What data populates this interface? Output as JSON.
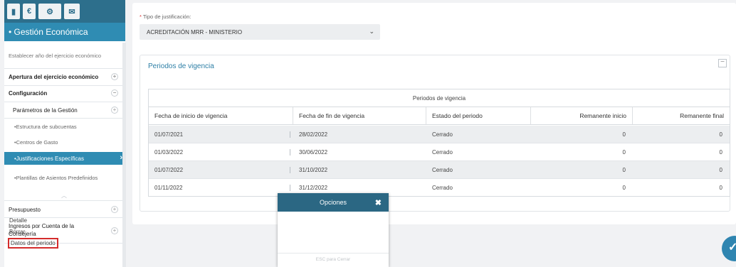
{
  "top_tabs": [
    {
      "icon": "book-icon",
      "glyph": "▮"
    },
    {
      "icon": "euro-icon",
      "glyph": "€"
    },
    {
      "icon": "cogs-icon",
      "glyph": "⚙"
    },
    {
      "icon": "mail-icon",
      "glyph": "✉"
    }
  ],
  "sidebar": {
    "header": "• Gestión Económica",
    "items": [
      {
        "label": "Establecer año del ejercicio económico"
      },
      {
        "label": "Apertura del ejercicio económico"
      },
      {
        "label": "Configuración"
      },
      {
        "label": "Parámetros de la Gestión"
      },
      {
        "label": "•Estructura de subcuentas"
      },
      {
        "label": "•Centros de Gasto"
      },
      {
        "label": "•Justificaciones Específicas"
      },
      {
        "label": "•Plantillas de Asientos Predefinidos"
      },
      {
        "label": "Presupuesto"
      },
      {
        "label": "Ingresos por Cuenta de la Consejería"
      }
    ]
  },
  "form": {
    "required_mark": "*",
    "label": "Tipo de justificación:",
    "selected_value": "ACREDITACIÓN MRR - MINISTERIO"
  },
  "card": {
    "title": "Periodos de vigencia"
  },
  "grid": {
    "title": "Periodos de vigencia",
    "columns": [
      "Fecha de inicio de vigencia",
      "Fecha de fin de vigencia",
      "Estado del periodo",
      "Remanente inicio",
      "Remanente final"
    ],
    "rows": [
      {
        "inicio": "01/07/2021",
        "fin": "28/02/2022",
        "estado": "Cerrado",
        "rem_inicio": "0",
        "rem_final": "0"
      },
      {
        "inicio": "01/03/2022",
        "fin": "30/06/2022",
        "estado": "Cerrado",
        "rem_inicio": "0",
        "rem_final": "0"
      },
      {
        "inicio": "01/07/2022",
        "fin": "31/10/2022",
        "estado": "Cerrado",
        "rem_inicio": "0",
        "rem_final": "0"
      },
      {
        "inicio": "01/11/2022",
        "fin": "31/12/2022",
        "estado": "Cerrado",
        "rem_inicio": "0",
        "rem_final": "0"
      }
    ]
  },
  "menu": {
    "title": "Opciones",
    "close": "✖",
    "items": [
      "Detalle",
      "Borrar",
      "Datos del periodo"
    ],
    "footer": "ESC para Cerrar"
  },
  "fab": {
    "glyph": "✓"
  }
}
